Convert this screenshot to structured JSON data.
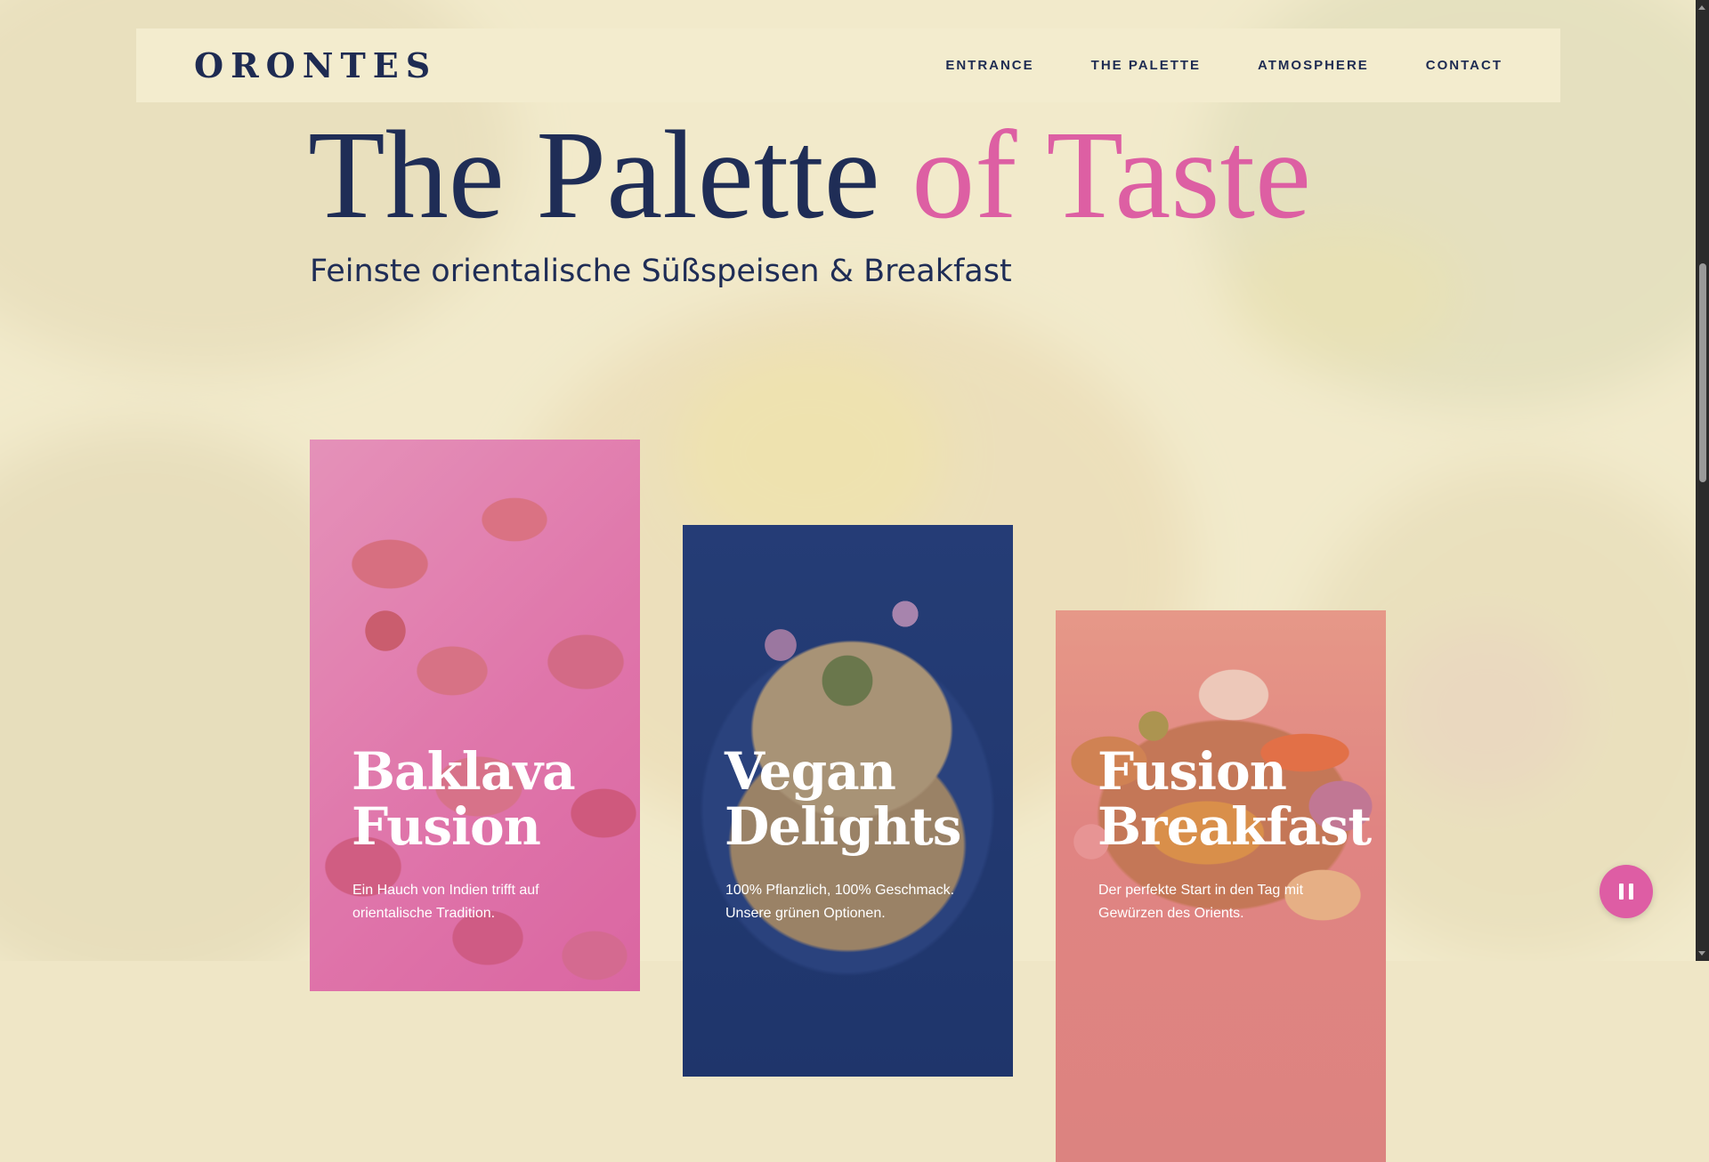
{
  "brand": {
    "logo": "ORONTES"
  },
  "nav": {
    "items": [
      {
        "label": "ENTRANCE"
      },
      {
        "label": "THE PALETTE"
      },
      {
        "label": "ATMOSPHERE"
      },
      {
        "label": "CONTACT"
      }
    ]
  },
  "hero": {
    "title_main": "The Palette",
    "title_accent": "of Taste",
    "subtitle": "Feinste orientalische Süßspeisen & Breakfast"
  },
  "cards": [
    {
      "title_line1": "Baklava",
      "title_line2": "Fusion",
      "text": "Ein Hauch von Indien trifft auf orientalische Tradition."
    },
    {
      "title_line1": "Vegan",
      "title_line2": "Delights",
      "text": "100% Pflanzlich, 100% Geschmack. Unsere grünen Optionen."
    },
    {
      "title_line1": "Fusion",
      "title_line2": "Breakfast",
      "text": "Der perfekte Start in den Tag mit Gewürzen des Orients."
    }
  ],
  "controls": {
    "pause_icon": "pause-icon"
  },
  "colors": {
    "navy": "#1f2d56",
    "pink_accent": "#dd5fa3",
    "cream": "#f3ecce",
    "pause_button": "#de5da4"
  }
}
